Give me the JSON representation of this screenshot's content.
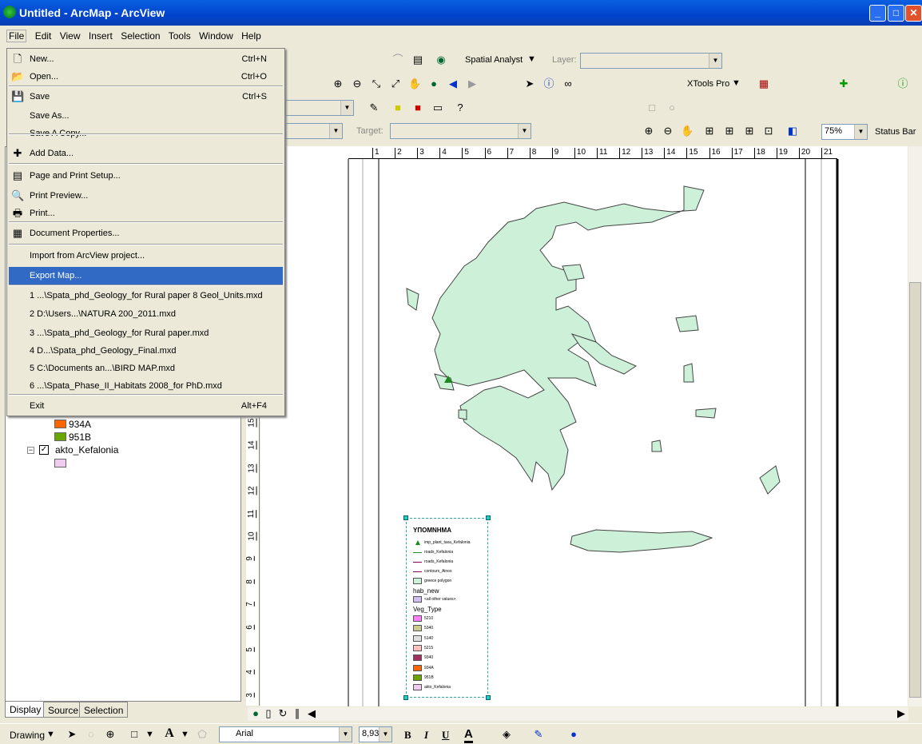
{
  "window": {
    "title": "Untitled - ArcMap - ArcView",
    "min": "_",
    "max": "□",
    "close": "✕"
  },
  "menubar": [
    "File",
    "Edit",
    "View",
    "Insert",
    "Selection",
    "Tools",
    "Window",
    "Help"
  ],
  "file_menu": {
    "items": [
      {
        "label": "New...",
        "shortcut": "Ctrl+N",
        "icon": "new-document-icon"
      },
      {
        "label": "Open...",
        "shortcut": "Ctrl+O",
        "icon": "open-folder-icon"
      },
      {
        "label": "Save",
        "shortcut": "Ctrl+S",
        "icon": "save-icon"
      },
      {
        "label": "Save As...",
        "shortcut": ""
      },
      {
        "label": "Save A Copy...",
        "shortcut": ""
      },
      {
        "label": "Add Data...",
        "shortcut": "",
        "icon": "add-data-icon"
      },
      {
        "label": "Page and Print Setup...",
        "shortcut": "",
        "icon": "page-setup-icon"
      },
      {
        "label": "Print Preview...",
        "shortcut": "",
        "icon": "print-preview-icon"
      },
      {
        "label": "Print...",
        "shortcut": "",
        "icon": "print-icon"
      },
      {
        "label": "Document Properties...",
        "shortcut": "",
        "icon": "document-properties-icon"
      },
      {
        "label": "Import from ArcView project...",
        "shortcut": ""
      },
      {
        "label": "Export Map...",
        "shortcut": "",
        "highlighted": true
      },
      {
        "label": "1 ...\\Spata_phd_Geology_for Rural paper 8 Geol_Units.mxd",
        "shortcut": ""
      },
      {
        "label": "2 D:\\Users...\\NATURA 200_2011.mxd",
        "shortcut": ""
      },
      {
        "label": "3 ...\\Spata_phd_Geology_for Rural paper.mxd",
        "shortcut": ""
      },
      {
        "label": "4 D...\\Spata_phd_Geology_Final.mxd",
        "shortcut": ""
      },
      {
        "label": "5 C:\\Documents an...\\BIRD MAP.mxd",
        "shortcut": ""
      },
      {
        "label": "6 ...\\Spata_Phase_II_Habitats 2008_for PhD.mxd",
        "shortcut": ""
      },
      {
        "label": "Exit",
        "shortcut": "Alt+F4"
      }
    ]
  },
  "toolbars": {
    "spatial_analyst": "Spatial Analyst",
    "layer_label": "Layer:",
    "xtools": "XTools Pro",
    "target_label": "Target:",
    "zoom": "75%",
    "status_bar": "Status Bar"
  },
  "toc": {
    "items": [
      {
        "label": "934A",
        "color": "#ff6600"
      },
      {
        "label": "951B",
        "color": "#6aa600"
      }
    ],
    "layer": "akto_Kefalonia",
    "layer_color": "#f0ccf0",
    "checked": true
  },
  "tabs": [
    "Display",
    "Source",
    "Selection"
  ],
  "ruler_h": [
    "1",
    "2",
    "3",
    "4",
    "5",
    "6",
    "7",
    "8",
    "9",
    "10",
    "11",
    "12",
    "13",
    "14",
    "15",
    "16",
    "17",
    "18",
    "19",
    "20",
    "21"
  ],
  "ruler_v": [
    "15",
    "14",
    "13",
    "12",
    "11",
    "10",
    "9",
    "8",
    "7",
    "6",
    "5",
    "4",
    "3"
  ],
  "legend": {
    "title": "ΥΠΟΜΝΗΜΑ",
    "rows": [
      {
        "label": "imp_plant_taxa_Kefalonia",
        "kind": "point",
        "color": "#1a8a1a"
      },
      {
        "label": "roads_Kefalonia",
        "kind": "line",
        "color": "#2a8a2a"
      },
      {
        "label": "roads_Kefalonia",
        "kind": "line",
        "color": "#800060"
      },
      {
        "label": "contours_Ainos",
        "kind": "line",
        "color": "#800060"
      },
      {
        "label": "greece polygon",
        "kind": "fill",
        "color": "#ccf0d8"
      }
    ],
    "group1": "hab_new",
    "group1_rows": [
      {
        "label": "<all other values>",
        "color": "#d0c0f0"
      }
    ],
    "group2": "Veg_Type",
    "group2_rows": [
      {
        "label": "5210",
        "color": "#ff80ff"
      },
      {
        "label": "5340",
        "color": "#cccc90"
      },
      {
        "label": "5140",
        "color": "#e0e0e0"
      },
      {
        "label": "5215",
        "color": "#ffc0c0"
      },
      {
        "label": "9340",
        "color": "#a03060"
      },
      {
        "label": "934A",
        "color": "#ff6600"
      },
      {
        "label": "951B",
        "color": "#6aa600"
      },
      {
        "label": "akto_Kefalonia",
        "color": "#f0ccf0"
      }
    ]
  },
  "drawing": {
    "label": "Drawing",
    "font": "Arial",
    "size": "8,93",
    "bold": "B",
    "italic": "I",
    "underline": "U",
    "font_color": "A"
  },
  "colors": {
    "map_fill": "#ccf0d8",
    "accent": "#316ac5"
  }
}
